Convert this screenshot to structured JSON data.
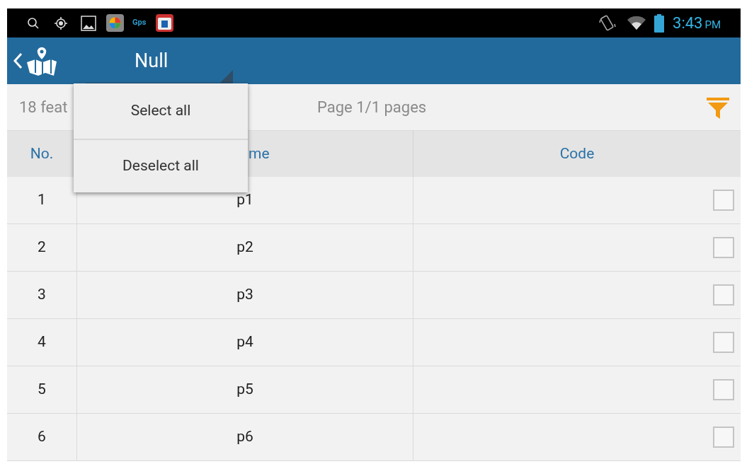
{
  "status_bar": {
    "gps_label": "Gps",
    "time": "3:43",
    "ampm": "PM"
  },
  "app_bar": {
    "title": "Null"
  },
  "dropdown": {
    "items": [
      "Select all",
      "Deselect all"
    ]
  },
  "info_bar": {
    "count": "18 feat",
    "page": "Page 1/1 pages"
  },
  "table": {
    "columns": [
      "No.",
      "me",
      "Code"
    ],
    "rows": [
      {
        "no": "1",
        "name": "p1",
        "checked": false
      },
      {
        "no": "2",
        "name": "p2",
        "checked": false
      },
      {
        "no": "3",
        "name": "p3",
        "checked": false
      },
      {
        "no": "4",
        "name": "p4",
        "checked": false
      },
      {
        "no": "5",
        "name": "p5",
        "checked": false
      },
      {
        "no": "6",
        "name": "p6",
        "checked": false
      }
    ]
  }
}
